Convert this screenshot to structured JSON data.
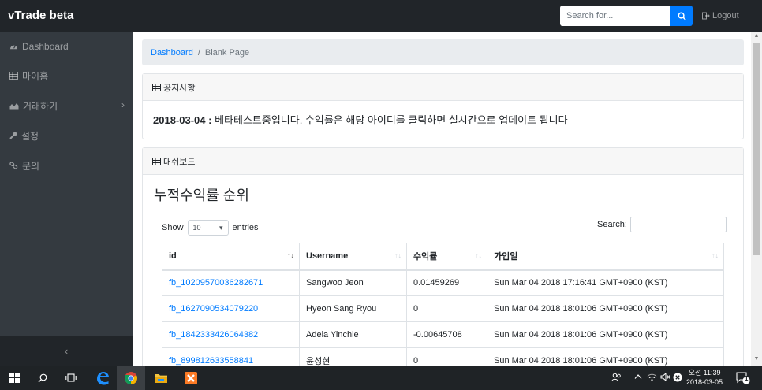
{
  "app": {
    "brand": "vTrade beta"
  },
  "topbar": {
    "search_placeholder": "Search for...",
    "logout_label": "Logout"
  },
  "sidebar": {
    "items": [
      {
        "label": "Dashboard",
        "icon": "tachometer-icon"
      },
      {
        "label": "마이홈",
        "icon": "table-icon"
      },
      {
        "label": "거래하기",
        "icon": "area-chart-icon"
      },
      {
        "label": "설정",
        "icon": "wrench-icon"
      },
      {
        "label": "문의",
        "icon": "link-icon"
      }
    ],
    "collapse_symbol": "‹"
  },
  "breadcrumb": {
    "home": "Dashboard",
    "sep": "/",
    "current": "Blank Page"
  },
  "notice_card": {
    "header": "공지사항",
    "date": "2018-03-04",
    "sep": " : ",
    "message": "베타테스트중입니다. 수익률은 해당 아이디를 클릭하면 실시간으로 업데이트 됩니다"
  },
  "dashboard_card": {
    "header": "대쉬보드",
    "title": "누적수익률 순위",
    "show_label": "Show",
    "entries_value": "10",
    "entries_label": "entries",
    "search_label": "Search:",
    "columns": [
      "id",
      "Username",
      "수익률",
      "가입일"
    ],
    "rows": [
      {
        "id": "fb_10209570036282671",
        "username": "Sangwoo Jeon",
        "rate": "0.01459269",
        "joined": "Sun Mar 04 2018 17:16:41 GMT+0900 (KST)"
      },
      {
        "id": "fb_1627090534079220",
        "username": "Hyeon Sang Ryou",
        "rate": "0",
        "joined": "Sun Mar 04 2018 18:01:06 GMT+0900 (KST)"
      },
      {
        "id": "fb_1842333426064382",
        "username": "Adela Yinchie",
        "rate": "-0.00645708",
        "joined": "Sun Mar 04 2018 18:01:06 GMT+0900 (KST)"
      },
      {
        "id": "fb_899812633558841",
        "username": "윤성현",
        "rate": "0",
        "joined": "Sun Mar 04 2018 18:01:06 GMT+0900 (KST)"
      }
    ]
  },
  "taskbar": {
    "time_line1": "오전 11:39",
    "time_line2": "2018-03-05",
    "notification_count": "1"
  },
  "colors": {
    "accent": "#007bff",
    "nav_dark": "#212529",
    "sidebar": "#343a40"
  }
}
